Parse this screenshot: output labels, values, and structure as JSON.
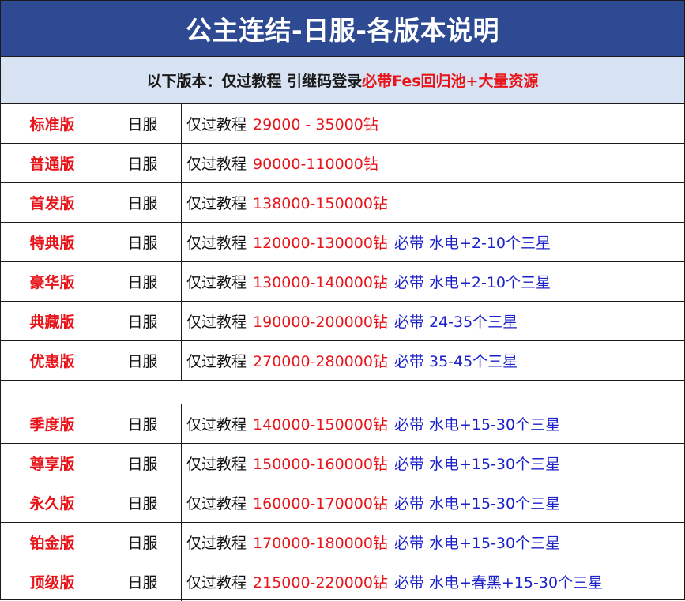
{
  "title": "公主连结-日服-各版本说明",
  "subtitle": {
    "prefix": "以下版本：仅过教程 引继码登录 ",
    "highlight": "必带Fes回归池+大量资源"
  },
  "section1": [
    {
      "name": "标准版",
      "server": "日服",
      "base": "仅过教程",
      "price": " 29000 - 35000钻",
      "extra": ""
    },
    {
      "name": "普通版",
      "server": "日服",
      "base": "仅过教程",
      "price": " 90000-110000钻",
      "extra": ""
    },
    {
      "name": "首发版",
      "server": "日服",
      "base": "仅过教程",
      "price": "138000-150000钻",
      "extra": ""
    },
    {
      "name": "特典版",
      "server": "日服",
      "base": "仅过教程",
      "price": "120000-130000钻",
      "extra": "必带 水电+2-10个三星"
    },
    {
      "name": "豪华版",
      "server": "日服",
      "base": "仅过教程",
      "price": "130000-140000钻",
      "extra": "必带 水电+2-10个三星"
    },
    {
      "name": "典藏版",
      "server": "日服",
      "base": "仅过教程",
      "price": "190000-200000钻",
      "extra": "必带 24-35个三星"
    },
    {
      "name": "优惠版",
      "server": "日服",
      "base": "仅过教程",
      "price": "270000-280000钻",
      "extra": "必带 35-45个三星"
    }
  ],
  "section2": [
    {
      "name": "季度版",
      "server": "日服",
      "base": "仅过教程",
      "price": "140000-150000钻",
      "extra": "必带 水电+15-30个三星"
    },
    {
      "name": "尊享版",
      "server": "日服",
      "base": "仅过教程",
      "price": "150000-160000钻",
      "extra": "必带 水电+15-30个三星"
    },
    {
      "name": "永久版",
      "server": "日服",
      "base": "仅过教程",
      "price": "160000-170000钻",
      "extra": "必带 水电+15-30个三星"
    },
    {
      "name": "铂金版",
      "server": "日服",
      "base": "仅过教程",
      "price": "170000-180000钻",
      "extra": "必带 水电+15-30个三星"
    },
    {
      "name": "顶级版",
      "server": "日服",
      "base": "仅过教程",
      "price": "215000-220000钻",
      "extra": "必带 水电+春黑+15-30个三星"
    }
  ],
  "colors": {
    "header_bg": "#2d4a93",
    "subheader_bg": "#d7e2f2",
    "red": "#e8151b",
    "blue": "#1c22c8"
  }
}
